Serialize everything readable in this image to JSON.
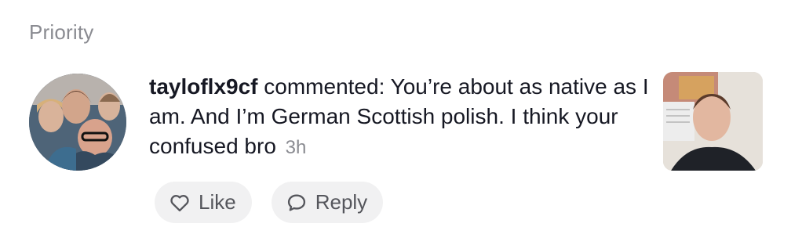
{
  "section": {
    "title": "Priority"
  },
  "notification": {
    "username": "tayloflx9cf",
    "text": " commented: You’re about as native as I am. And I’m German Scottish polish. I think your confused bro",
    "time": "3h"
  },
  "actions": {
    "like_label": "Like",
    "reply_label": "Reply"
  },
  "icons": {
    "like": "heart-outline-icon",
    "reply": "speech-bubble-icon"
  },
  "colors": {
    "muted_text": "#8a8b91",
    "pill_bg": "#f1f1f2"
  }
}
